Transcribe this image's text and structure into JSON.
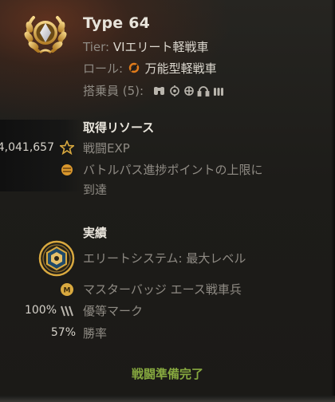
{
  "vehicle": {
    "name": "Type 64",
    "tier_label": "Tier:",
    "tier_value": "VIエリート軽戦車",
    "role_label": "ロール:",
    "role_value": "万能型軽戦車",
    "crew_label": "搭乗員 (5):",
    "crew_icons": [
      "binoculars-icon",
      "gunner-sight-icon",
      "loader-sight-icon",
      "radio-headset-icon",
      "ammo-icon"
    ]
  },
  "resources": {
    "heading": "取得リソース",
    "exp_value": "4,041,657",
    "exp_label": "戦闘EXP",
    "battlepass_text_1": "バトルパス進捗ポイントの上限に",
    "battlepass_text_2": "到達"
  },
  "achievements": {
    "heading": "実績",
    "elite_label": "エリートシステム:",
    "elite_value": "最大レベル",
    "mastery_label": "マスターバッジ エース戦車兵",
    "marks_value": "100%",
    "marks_label": "優等マーク",
    "winrate_value": "57%",
    "winrate_label": "勝率"
  },
  "status": {
    "ready_label": "戦闘準備完了"
  },
  "colors": {
    "gold": "#d9a93f",
    "ready_green": "#86a83f",
    "accent_orange": "#e07b1a"
  }
}
